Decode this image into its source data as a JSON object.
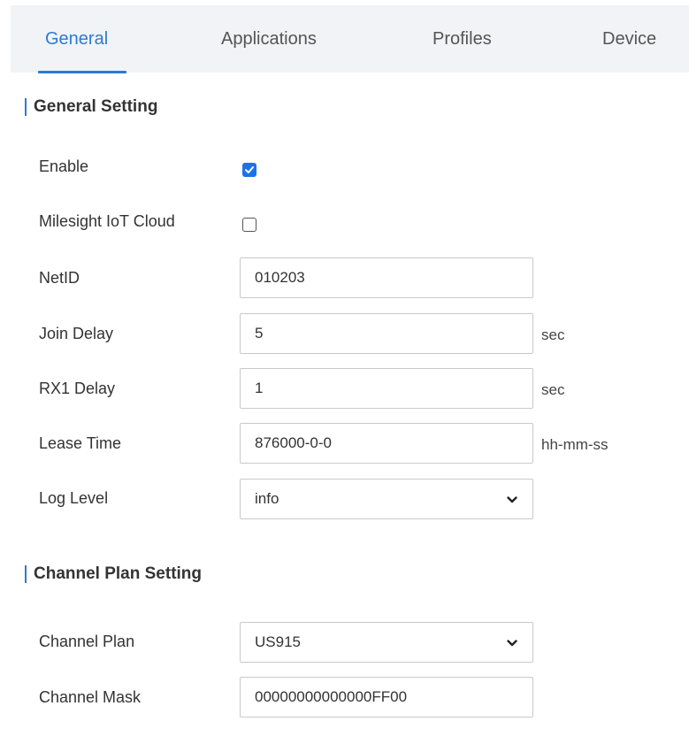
{
  "tabs": [
    {
      "label": "General",
      "active": true
    },
    {
      "label": "Applications",
      "active": false
    },
    {
      "label": "Profiles",
      "active": false
    },
    {
      "label": "Device",
      "active": false
    }
  ],
  "general_setting": {
    "title": "General Setting",
    "enable": {
      "label": "Enable",
      "checked": true
    },
    "milesight_cloud": {
      "label": "Milesight IoT Cloud",
      "checked": false
    },
    "netid": {
      "label": "NetID",
      "value": "010203"
    },
    "join_delay": {
      "label": "Join Delay",
      "value": "5",
      "unit": "sec"
    },
    "rx1_delay": {
      "label": "RX1 Delay",
      "value": "1",
      "unit": "sec"
    },
    "lease_time": {
      "label": "Lease Time",
      "value": "876000-0-0",
      "unit": "hh-mm-ss"
    },
    "log_level": {
      "label": "Log Level",
      "selected": "info"
    }
  },
  "channel_plan_setting": {
    "title": "Channel Plan Setting",
    "channel_plan": {
      "label": "Channel Plan",
      "selected": "US915"
    },
    "channel_mask": {
      "label": "Channel Mask",
      "value": "00000000000000FF00"
    }
  },
  "colors": {
    "accent": "#2b7bd1",
    "checkbox_checked": "#1a73e8",
    "tabbar_bg": "#f1f3f6",
    "border": "#c9c9c9"
  },
  "icons": {
    "checkmark": "check-icon",
    "dropdown": "chevron-down-icon"
  }
}
